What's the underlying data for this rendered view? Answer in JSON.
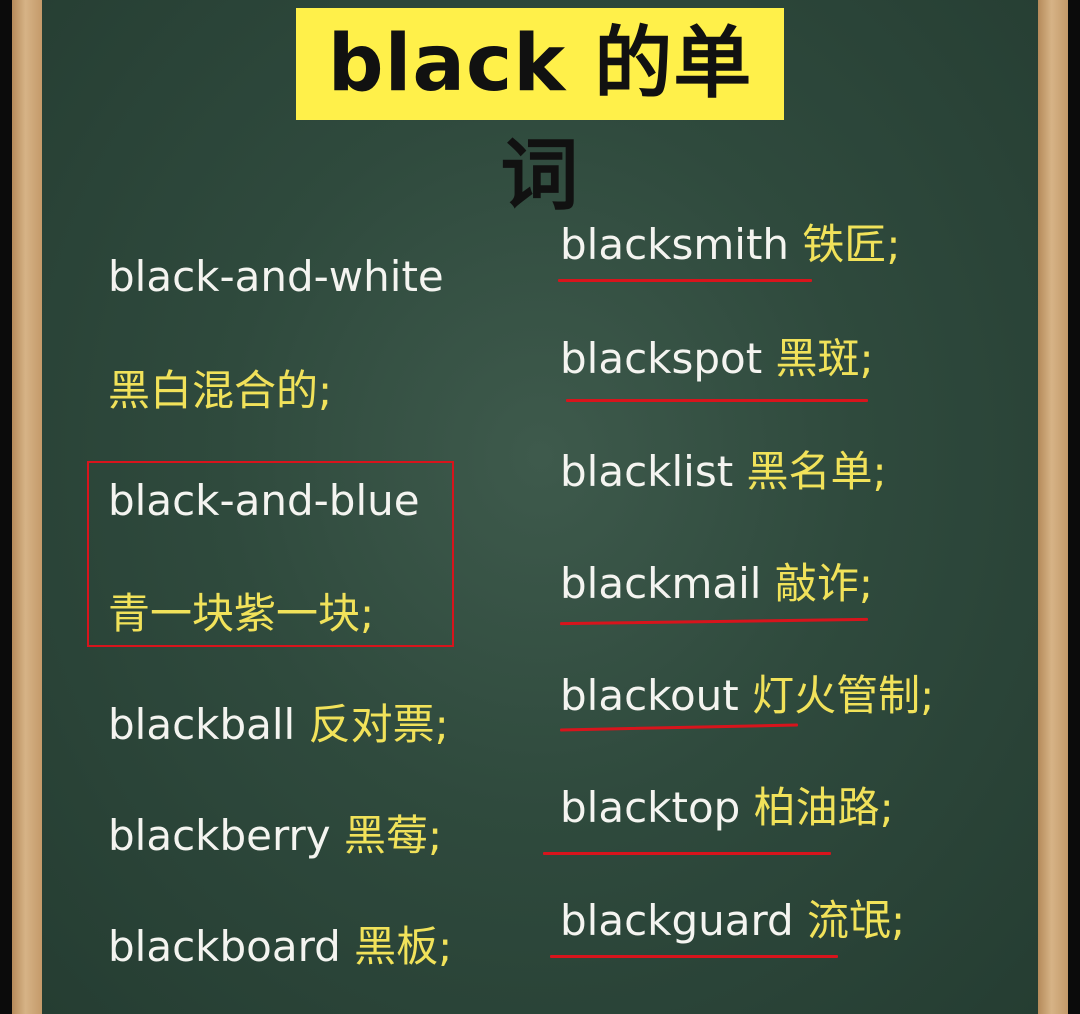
{
  "title": "black 的单词",
  "left_column": {
    "item1": {
      "word": "black-and-white",
      "meaning": "黑白混合的;"
    },
    "item2": {
      "word": "black-and-blue",
      "meaning": "青一块紫一块;"
    },
    "item3": {
      "word": "blackball",
      "meaning": "反对票;"
    },
    "item4": {
      "word": "blackberry",
      "meaning": "黑莓;"
    },
    "item5": {
      "word": "blackboard",
      "meaning": "黑板;"
    }
  },
  "right_column": {
    "item1": {
      "word": "blacksmith",
      "meaning": "铁匠;"
    },
    "item2": {
      "word": "blackspot",
      "meaning": "黑斑;"
    },
    "item3": {
      "word": "blacklist",
      "meaning": "黑名单;"
    },
    "item4": {
      "word": "blackmail",
      "meaning": "敲诈;"
    },
    "item5": {
      "word": "blackout",
      "meaning": "灯火管制;"
    },
    "item6": {
      "word": "blacktop",
      "meaning": "柏油路;"
    },
    "item7": {
      "word": "blackguard",
      "meaning": "流氓;"
    }
  },
  "colors": {
    "title_bg": "#fff04a",
    "word": "#f4f4f0",
    "meaning": "#f1e25a",
    "underline": "#d8141c",
    "board": "#2f4a3d"
  }
}
